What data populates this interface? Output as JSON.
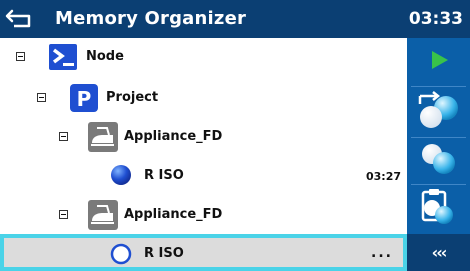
{
  "header": {
    "title": "Memory Organizer",
    "clock": "03:33"
  },
  "tree": {
    "node_label": "Node",
    "project_label": "Project",
    "appliance1_label": "Appliance_FD",
    "test1_label": "R ISO",
    "test1_time": "03:27",
    "appliance2_label": "Appliance_FD",
    "test2_label": "R ISO",
    "test2_status": "..."
  },
  "sidebar": {
    "collapse_label": "‹‹‹"
  },
  "colors": {
    "header_bg": "#0b3f73",
    "sidebar_bg": "#0b5fa8",
    "selection_border": "#4ad3e8",
    "play_green": "#39c24a"
  },
  "icons": {
    "back": "back-arrow-icon",
    "node": "terminal-prompt-icon",
    "project": "project-p-icon",
    "appliance": "iron-appliance-icon",
    "test_done": "filled-circle-icon",
    "test_pending": "empty-circle-icon",
    "run": "play-icon",
    "clone": "clone-arrow-icon",
    "copy": "copy-circles-icon",
    "paste": "paste-clipboard-icon"
  }
}
